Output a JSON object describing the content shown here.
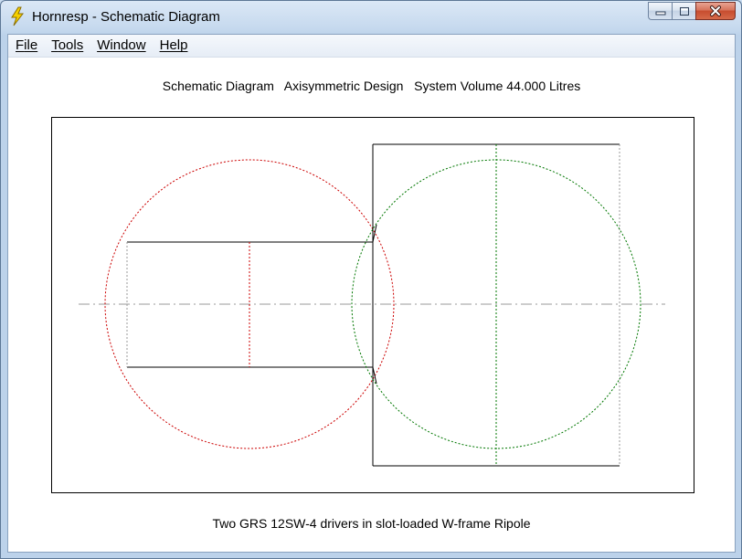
{
  "window": {
    "title": "Hornresp - Schematic Diagram"
  },
  "menu": {
    "items": [
      "File",
      "Tools",
      "Window",
      "Help"
    ]
  },
  "diagram": {
    "heading": "Schematic Diagram   Axisymmetric Design   System Volume 44.000 Litres",
    "caption": "Two GRS 12SW-4 drivers in slot-loaded W-frame Ripole",
    "colors": {
      "left_driver": "#cc0000",
      "right_driver": "#007700",
      "outline": "#000000",
      "axis": "#9a9a9a"
    }
  },
  "icons": {
    "app": "lightning-bolt-icon",
    "minimize": "minimize-icon",
    "maximize": "maximize-icon",
    "close": "close-icon"
  }
}
